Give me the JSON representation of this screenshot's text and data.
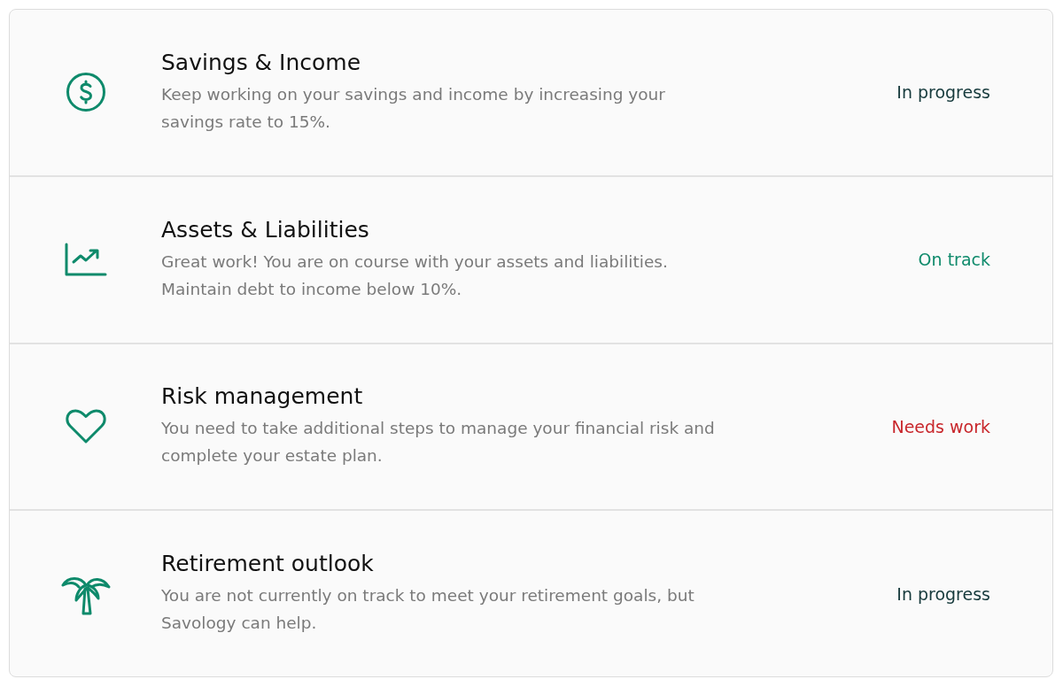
{
  "categories": [
    {
      "title": "Savings & Income",
      "description": "Keep working on your savings and income by increasing your savings rate to 15%.",
      "status": "In progress",
      "color": "#163a3c"
    },
    {
      "title": "Assets & Liabilities",
      "description": "Great work! You are on course with your assets and liabilities. Maintain debt to income below 10%.",
      "status": "On track",
      "color": "#0e8a6b"
    },
    {
      "title": "Risk management",
      "description": "You need to take additional steps to manage your financial risk and complete your estate plan.",
      "status": "Needs work",
      "color": "#c8262b"
    },
    {
      "title": "Retirement outlook",
      "description": "You are not currently on track to meet your retirement goals, but Savology can help.",
      "status": "In progress",
      "color": "#163a3c"
    }
  ]
}
